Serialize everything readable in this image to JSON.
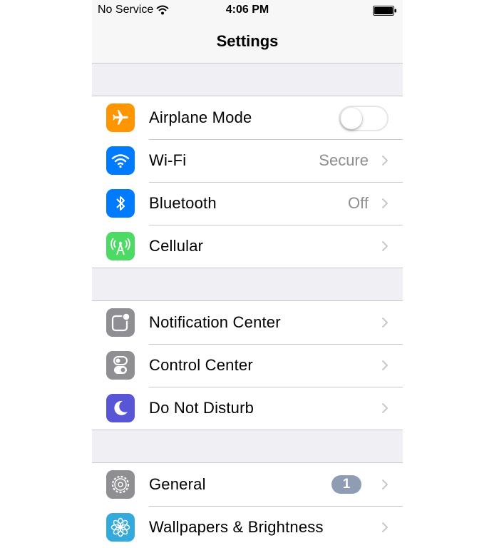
{
  "status_bar": {
    "carrier": "No Service",
    "time": "4:06 PM"
  },
  "nav": {
    "title": "Settings"
  },
  "groups": [
    {
      "rows": [
        {
          "label": "Airplane Mode",
          "icon": "airplane-icon",
          "icon_color": "#ff9500",
          "control": "toggle",
          "toggle_on": false
        },
        {
          "label": "Wi-Fi",
          "icon": "wifi-icon",
          "icon_color": "#007aff",
          "value": "Secure"
        },
        {
          "label": "Bluetooth",
          "icon": "bluetooth-icon",
          "icon_color": "#007aff",
          "value": "Off"
        },
        {
          "label": "Cellular",
          "icon": "cellular-icon",
          "icon_color": "#4cd964"
        }
      ]
    },
    {
      "rows": [
        {
          "label": "Notification Center",
          "icon": "notification-center-icon",
          "icon_color": "#8e8e93"
        },
        {
          "label": "Control Center",
          "icon": "control-center-icon",
          "icon_color": "#8e8e93"
        },
        {
          "label": "Do Not Disturb",
          "icon": "moon-icon",
          "icon_color": "#5856d6"
        }
      ]
    },
    {
      "rows": [
        {
          "label": "General",
          "icon": "gear-icon",
          "icon_color": "#8e8e93",
          "badge": "1"
        },
        {
          "label": "Wallpapers & Brightness",
          "icon": "flower-icon",
          "icon_color": "#34aadc"
        }
      ]
    }
  ],
  "colors": {
    "separator": "#c8c7cc",
    "group_background": "#efeff4",
    "secondary_text": "#8e8e93",
    "badge": "#8e9cb4"
  }
}
